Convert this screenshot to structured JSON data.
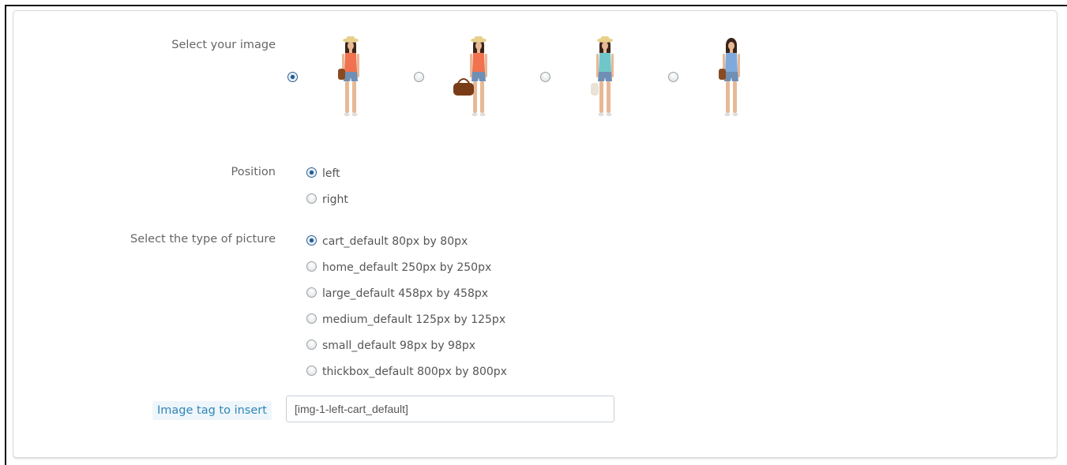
{
  "form": {
    "image_label": "Select your image",
    "images": [
      {
        "alt": "model-1",
        "selected": true,
        "top_color": "#f0724f",
        "bag_color": "#8a4a22",
        "hat": true
      },
      {
        "alt": "model-2",
        "selected": false,
        "top_color": "#f0724f",
        "bag_color": "#7a3c17",
        "hat": true
      },
      {
        "alt": "model-3",
        "selected": false,
        "top_color": "#6fc7c9",
        "bag_color": "#e8e3d6",
        "hat": true
      },
      {
        "alt": "model-4",
        "selected": false,
        "top_color": "#7fa9db",
        "bag_color": "#8a4a22",
        "hat": false
      }
    ],
    "position_label": "Position",
    "position_options": [
      {
        "label": "left",
        "selected": true
      },
      {
        "label": "right",
        "selected": false
      }
    ],
    "picture_type_label": "Select the type of picture",
    "picture_types": [
      {
        "label": "cart_default 80px by 80px",
        "selected": true
      },
      {
        "label": "home_default 250px by 250px",
        "selected": false
      },
      {
        "label": "large_default 458px by 458px",
        "selected": false
      },
      {
        "label": "medium_default 125px by 125px",
        "selected": false
      },
      {
        "label": "small_default 98px by 98px",
        "selected": false
      },
      {
        "label": "thickbox_default 800px by 800px",
        "selected": false
      }
    ],
    "tag_label": "Image tag to insert",
    "tag_value": "[img-1-left-cart_default]"
  },
  "colors": {
    "accent": "#2f86b8",
    "radio_checked": "#1d4f7f",
    "panel_border": "#d3d8db"
  }
}
